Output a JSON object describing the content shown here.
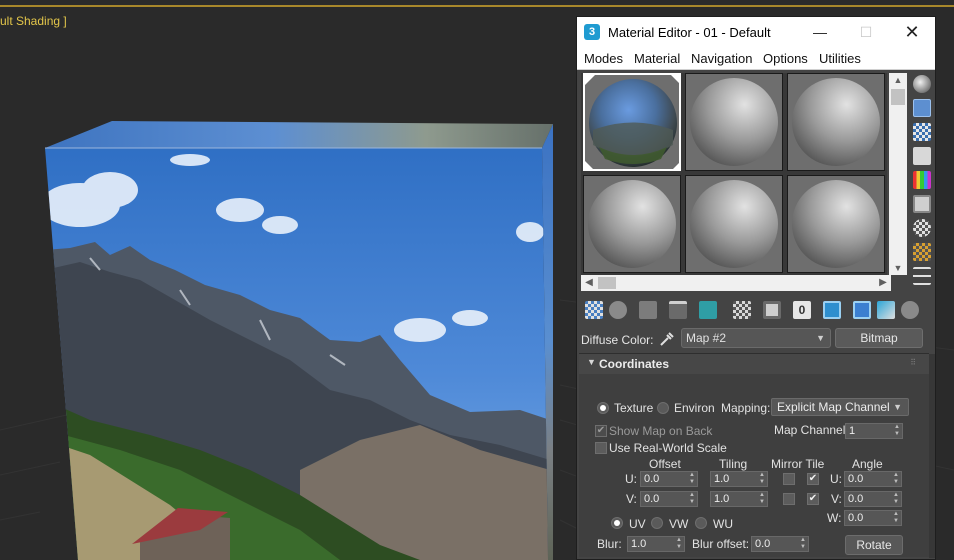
{
  "viewport": {
    "label": "ult Shading ]"
  },
  "material_editor": {
    "title": "Material Editor - 01 - Default",
    "app_icon": "3",
    "window_controls": {
      "minimize": "—",
      "maximize": "☐",
      "close": "✕"
    },
    "menu": [
      "Modes",
      "Material",
      "Navigation",
      "Options",
      "Utilities"
    ],
    "diffuse": {
      "label": "Diffuse Color:",
      "map_value": "Map #2",
      "bitmap_button": "Bitmap"
    },
    "coordinates": {
      "title": "Coordinates",
      "texture_label": "Texture",
      "environ_label": "Environ",
      "mapping_label": "Mapping:",
      "mapping_value": "Explicit Map Channel",
      "show_map_on_back": "Show Map on Back",
      "map_channel_label": "Map Channel:",
      "map_channel_value": "1",
      "use_real_world_scale": "Use Real-World Scale",
      "headers": {
        "offset": "Offset",
        "tiling": "Tiling",
        "mirror_tile": "Mirror Tile",
        "angle": "Angle"
      },
      "u_label": "U:",
      "v_label": "V:",
      "w_label": "W:",
      "offset_u": "0.0",
      "offset_v": "0.0",
      "tiling_u": "1.0",
      "tiling_v": "1.0",
      "angle_u": "0.0",
      "angle_v": "0.0",
      "angle_w": "0.0",
      "uv_label": "UV",
      "vw_label": "VW",
      "wu_label": "WU",
      "blur_label": "Blur:",
      "blur_value": "1.0",
      "blur_offset_label": "Blur offset:",
      "blur_offset_value": "0.0",
      "rotate_button": "Rotate"
    }
  }
}
